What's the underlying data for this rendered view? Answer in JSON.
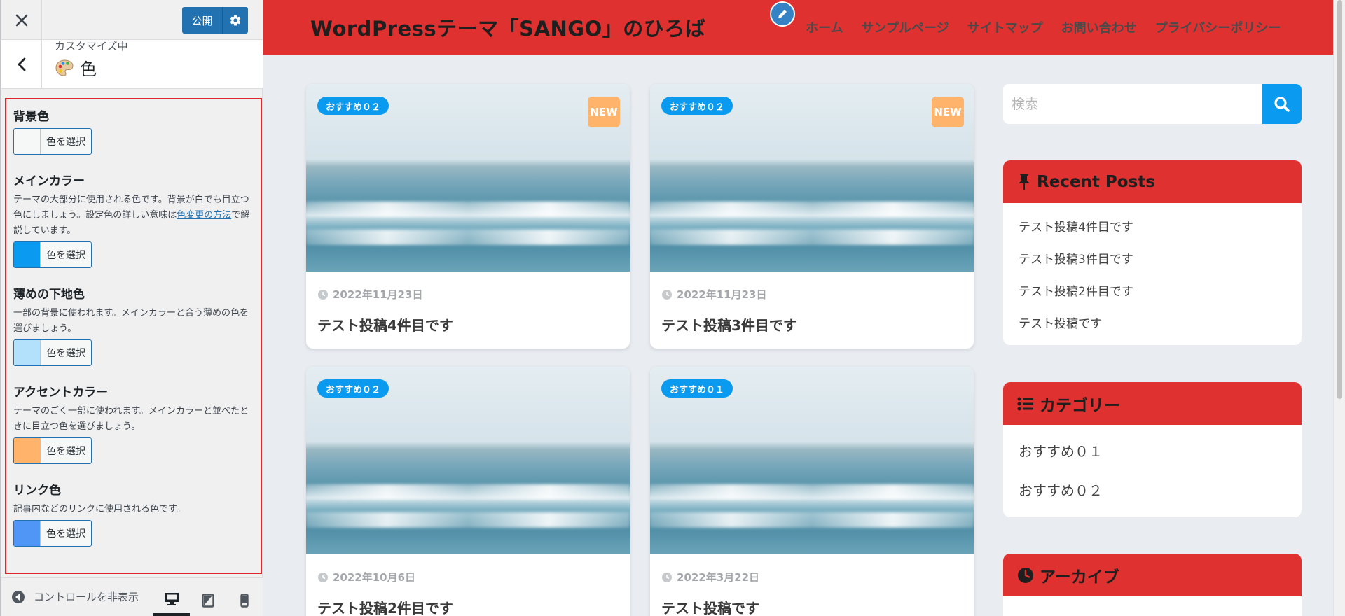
{
  "customizer": {
    "publish_label": "公開",
    "customizing_label": "カスタマイズ中",
    "section_title": "色",
    "controls": [
      {
        "title": "背景色",
        "desc": "",
        "swatch": "#f6f7f7",
        "button": "色を選択"
      },
      {
        "title": "メインカラー",
        "desc": "テーマの大部分に使用される色です。背景が白でも目立つ色にしましょう。設定色の詳しい意味は",
        "link": "色変更の方法",
        "desc_after": "で解説しています。",
        "swatch": "#0a9af0",
        "button": "色を選択"
      },
      {
        "title": "薄めの下地色",
        "desc": "一部の背景に使われます。メインカラーと合う薄めの色を選びましょう。",
        "swatch": "#b3e1fb",
        "button": "色を選択"
      },
      {
        "title": "アクセントカラー",
        "desc": "テーマのごく一部に使われます。メインカラーと並べたときに目立つ色を選びましょう。",
        "swatch": "#ffb36b",
        "button": "色を選択"
      },
      {
        "title": "リンク色",
        "desc": "記事内などのリンクに使用される色です。",
        "swatch": "#4f96f6",
        "button": "色を選択"
      }
    ],
    "hide_controls_label": "コントロールを非表示"
  },
  "site": {
    "title": "WordPressテーマ「SANGO」のひろば",
    "nav": [
      "ホーム",
      "サンプルページ",
      "サイトマップ",
      "お問い合わせ",
      "プライバシーポリシー"
    ],
    "header_color": "#e03131",
    "main_color": "#0a9af0"
  },
  "posts": [
    {
      "category": "おすすめ０２",
      "new_badge": "NEW",
      "date": "2022年11月23日",
      "title": "テスト投稿4件目です"
    },
    {
      "category": "おすすめ０２",
      "new_badge": "NEW",
      "date": "2022年11月23日",
      "title": "テスト投稿3件目です"
    },
    {
      "category": "おすすめ０２",
      "new_badge": "",
      "date": "2022年10月6日",
      "title": "テスト投稿2件目です"
    },
    {
      "category": "おすすめ０１",
      "new_badge": "",
      "date": "2022年3月22日",
      "title": "テスト投稿です"
    }
  ],
  "sidebar": {
    "search_placeholder": "検索",
    "recent_title": "Recent Posts",
    "recent_posts": [
      "テスト投稿4件目です",
      "テスト投稿3件目です",
      "テスト投稿2件目です",
      "テスト投稿です"
    ],
    "categories_title": "カテゴリー",
    "categories": [
      "おすすめ０１",
      "おすすめ０２"
    ],
    "archive_title": "アーカイブ"
  }
}
